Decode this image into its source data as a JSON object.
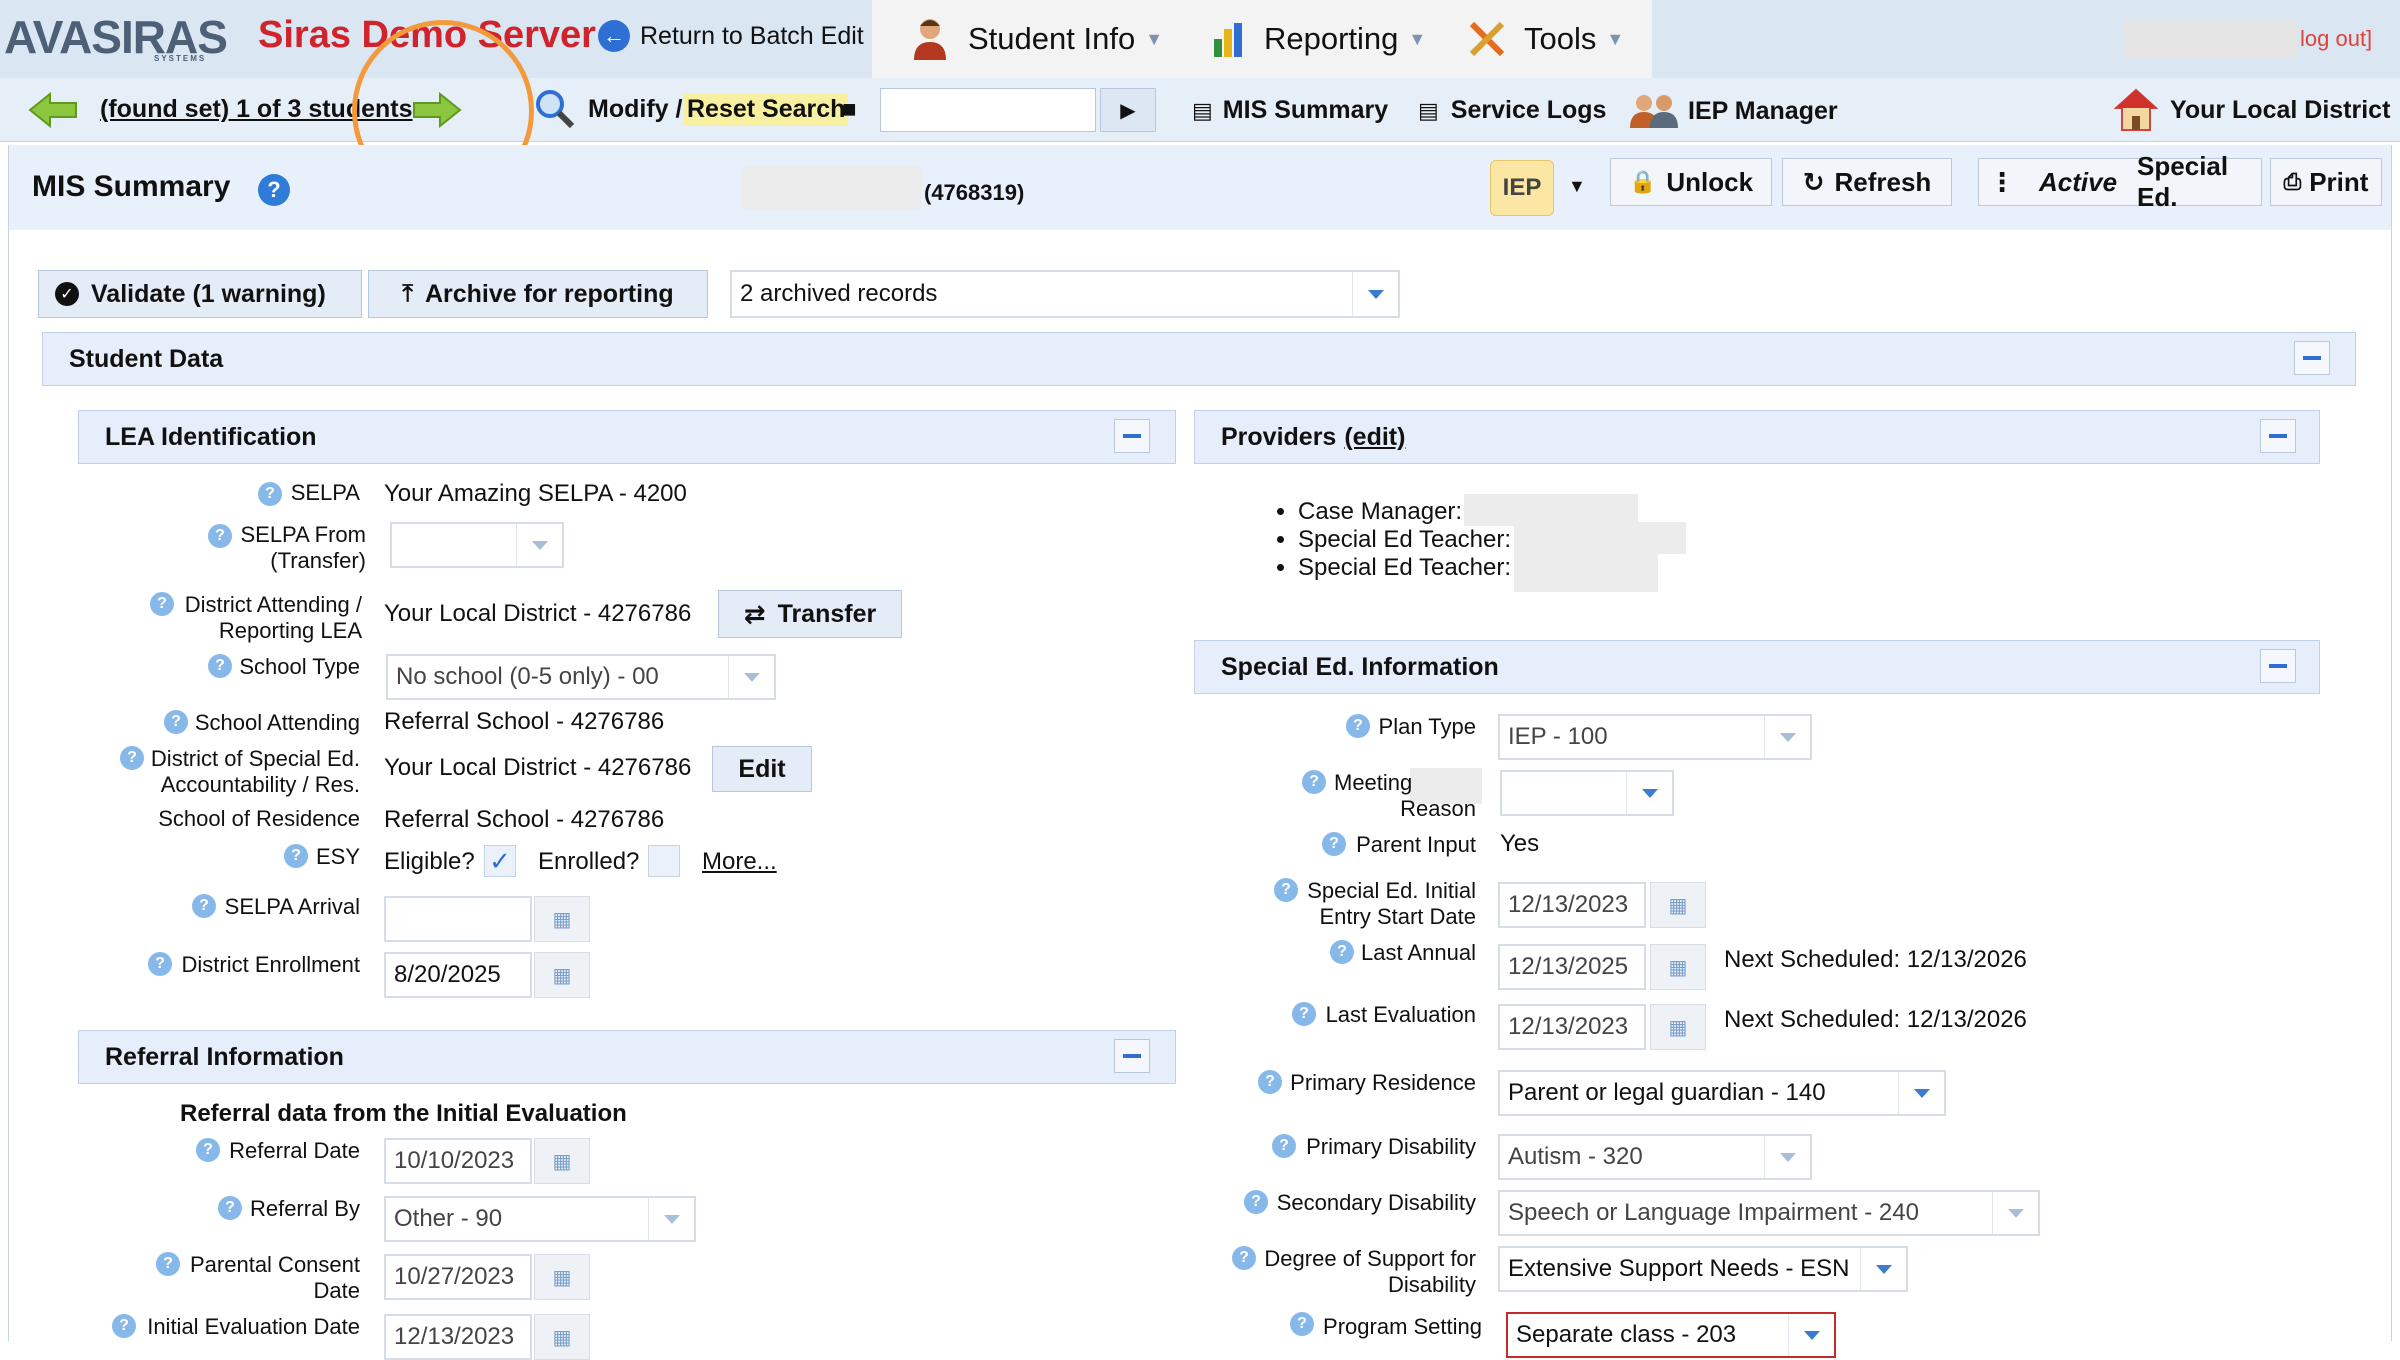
{
  "topbar": {
    "logo": "AVASIRAS",
    "logo_sub": "SYSTEMS",
    "server_title": "Siras Demo Server",
    "return_label": "Return to Batch Edit",
    "menu": [
      {
        "label": "Student Info",
        "icon": "student-icon"
      },
      {
        "label": "Reporting",
        "icon": "reporting-icon"
      },
      {
        "label": "Tools",
        "icon": "tools-icon"
      }
    ],
    "logout": "log out]"
  },
  "navbar": {
    "found_set": "(found set) 1 of 3 students",
    "modify": "Modify /",
    "reset_search": "Reset Search",
    "search_value": "",
    "mis_summary": "MIS Summary",
    "service_logs": "Service Logs",
    "iep_manager": "IEP Manager",
    "district": "Your Local District"
  },
  "header": {
    "title": "MIS Summary",
    "student_id": "(4768319)",
    "iep_badge": "IEP",
    "unlock": "Unlock",
    "refresh": "Refresh",
    "active": "Active",
    "special_ed": "Special Ed.",
    "print": "Print"
  },
  "actions": {
    "validate": "Validate (1 warning)",
    "archive": "Archive for reporting",
    "archived_records": "2 archived records"
  },
  "student_data": {
    "title": "Student Data"
  },
  "lea": {
    "title": "LEA Identification",
    "selpa_label": "SELPA",
    "selpa_value": "Your Amazing SELPA - 4200",
    "selpa_from_label1": "SELPA From",
    "selpa_from_label2": "(Transfer)",
    "selpa_from_value": "",
    "district_attending_label1": "District Attending /",
    "district_attending_label2": "Reporting LEA",
    "district_attending_value": "Your Local District - 4276786",
    "transfer_button": "Transfer",
    "school_type_label": "School Type",
    "school_type_value": "No school (0-5 only) - 00",
    "school_attending_label": "School Attending",
    "school_attending_value": "Referral School - 4276786",
    "district_special_label1": "District of Special Ed.",
    "district_special_label2": "Accountability / Res.",
    "district_special_value": "Your Local District - 4276786",
    "edit_button": "Edit",
    "school_residence_label": "School of Residence",
    "school_residence_value": "Referral School - 4276786",
    "esy_label": "ESY",
    "eligible_label": "Eligible?",
    "enrolled_label": "Enrolled?",
    "more_link": "More...",
    "selpa_arrival_label": "SELPA Arrival",
    "selpa_arrival_value": "",
    "district_enrollment_label": "District Enrollment",
    "district_enrollment_value": "8/20/2025"
  },
  "referral": {
    "title": "Referral Information",
    "subtitle": "Referral data from the Initial Evaluation",
    "referral_date_label": "Referral Date",
    "referral_date_value": "10/10/2023",
    "referral_by_label": "Referral By",
    "referral_by_value": "Other - 90",
    "parental_consent_label1": "Parental Consent",
    "parental_consent_label2": "Date",
    "parental_consent_value": "10/27/2023",
    "initial_eval_label": "Initial Evaluation Date",
    "initial_eval_value": "12/13/2023"
  },
  "providers": {
    "title": "Providers",
    "edit_link": "(edit)",
    "items": [
      "Case Manager:",
      "Special Ed Teacher:",
      "Special Ed Teacher:"
    ]
  },
  "special_ed": {
    "title": "Special Ed. Information",
    "plan_type_label": "Plan Type",
    "plan_type_value": "IEP - 100",
    "meeting_label1": "Meeting",
    "meeting_label2": "Reason",
    "meeting_value": "",
    "parent_input_label": "Parent Input",
    "parent_input_value": "Yes",
    "initial_entry_label1": "Special Ed. Initial",
    "initial_entry_label2": "Entry Start Date",
    "initial_entry_value": "12/13/2023",
    "last_annual_label": "Last Annual",
    "last_annual_value": "12/13/2025",
    "last_annual_next": "Next Scheduled: 12/13/2026",
    "last_eval_label": "Last Evaluation",
    "last_eval_value": "12/13/2023",
    "last_eval_next": "Next Scheduled: 12/13/2026",
    "primary_residence_label": "Primary Residence",
    "primary_residence_value": "Parent or legal guardian - 140",
    "primary_disability_label": "Primary Disability",
    "primary_disability_value": "Autism - 320",
    "secondary_disability_label": "Secondary Disability",
    "secondary_disability_value": "Speech or Language Impairment - 240",
    "degree_support_label1": "Degree of Support for",
    "degree_support_label2": "Disability",
    "degree_support_value": "Extensive Support Needs - ESN",
    "program_setting_label": "Program Setting",
    "program_setting_value": "Separate class - 203"
  },
  "colors": {
    "accent": "#2f6fd4",
    "brand_red": "#d0232b",
    "highlight_ring": "#f39a3c",
    "reset_highlight": "#f7f0a0"
  }
}
